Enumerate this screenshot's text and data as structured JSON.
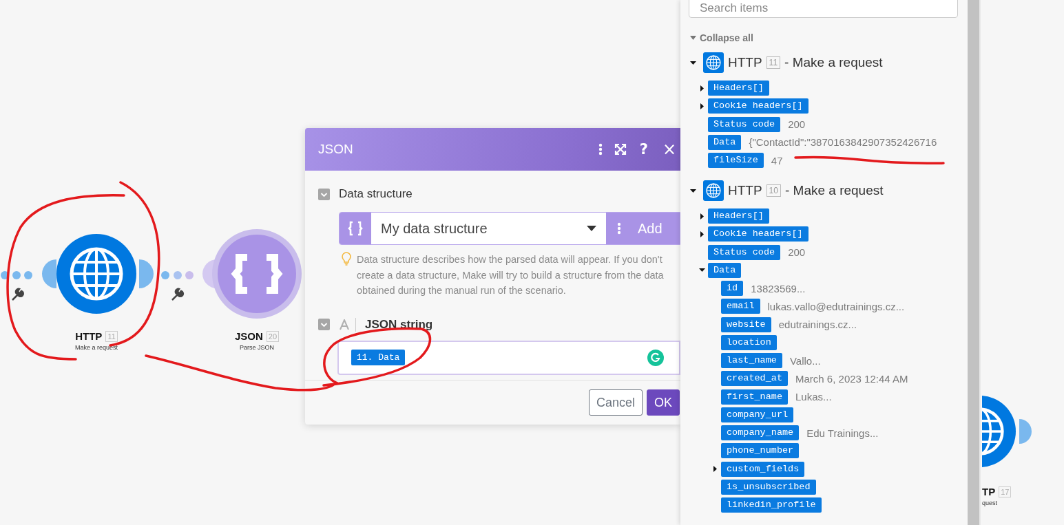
{
  "nodes": [
    {
      "kind": "http",
      "app": "HTTP",
      "badge": "11",
      "subtitle": "Make a request"
    },
    {
      "kind": "json",
      "app": "JSON",
      "badge": "20",
      "subtitle": "Parse JSON"
    }
  ],
  "partial_node": {
    "kind": "http",
    "app": "TP",
    "badge": "17",
    "subtitle": "quest"
  },
  "dialog": {
    "title": "JSON",
    "help": "?",
    "close": "×",
    "fields": [
      {
        "kind": "structure",
        "label": "Data structure",
        "expanded": true,
        "value": "My data structure",
        "add": "Add",
        "hint": "Data structure describes how the parsed data will appear. If you don't create a data structure, Make will try to build a structure from the data obtained during the manual run of the scenario."
      },
      {
        "kind": "text",
        "label": "JSON string",
        "expanded": true,
        "chip": "11. Data"
      }
    ],
    "buttons": [
      {
        "kind": "secondary",
        "label": "Cancel"
      },
      {
        "kind": "primary",
        "label": "OK"
      }
    ]
  },
  "panel": {
    "search": {
      "placeholder": "Search items"
    },
    "collapse_all": "Collapse all",
    "modules": [
      {
        "app": "HTTP",
        "badge": "11",
        "action": "- Make a request",
        "expanded": true,
        "items": [
          {
            "key": "Headers[]",
            "kind": "branch",
            "expanded": false
          },
          {
            "key": "Cookie headers[]",
            "kind": "branch",
            "expanded": false
          },
          {
            "key": "Status code",
            "kind": "leaf",
            "value": "200"
          },
          {
            "key": "Data",
            "kind": "leaf",
            "value": "{\"ContactId\":\"3870163842907352426716"
          },
          {
            "key": "fileSize",
            "kind": "leaf",
            "value": "47"
          }
        ]
      },
      {
        "app": "HTTP",
        "badge": "10",
        "action": "- Make a request",
        "expanded": true,
        "items": [
          {
            "key": "Headers[]",
            "kind": "branch",
            "expanded": false
          },
          {
            "key": "Cookie headers[]",
            "kind": "branch",
            "expanded": false
          },
          {
            "key": "Status code",
            "kind": "leaf",
            "value": "200"
          },
          {
            "key": "Data",
            "kind": "branch",
            "expanded": true,
            "children": [
              {
                "key": "id",
                "kind": "leaf",
                "value": "13823569..."
              },
              {
                "key": "email",
                "kind": "leaf",
                "value": "lukas.vallo@edutrainings.cz..."
              },
              {
                "key": "website",
                "kind": "leaf",
                "value": "edutrainings.cz..."
              },
              {
                "key": "location",
                "kind": "leaf"
              },
              {
                "key": "last_name",
                "kind": "leaf",
                "value": "Vallo..."
              },
              {
                "key": "created_at",
                "kind": "leaf",
                "value": "March 6, 2023 12:44 AM"
              },
              {
                "key": "first_name",
                "kind": "leaf",
                "value": "Lukas..."
              },
              {
                "key": "company_url",
                "kind": "leaf"
              },
              {
                "key": "company_name",
                "kind": "leaf",
                "value": "Edu Trainings..."
              },
              {
                "key": "phone_number",
                "kind": "leaf"
              },
              {
                "key": "custom_fields",
                "kind": "branch",
                "expanded": false
              },
              {
                "key": "is_unsubscribed",
                "kind": "leaf"
              },
              {
                "key": "linkedin_profile",
                "kind": "leaf"
              }
            ]
          }
        ]
      }
    ]
  }
}
